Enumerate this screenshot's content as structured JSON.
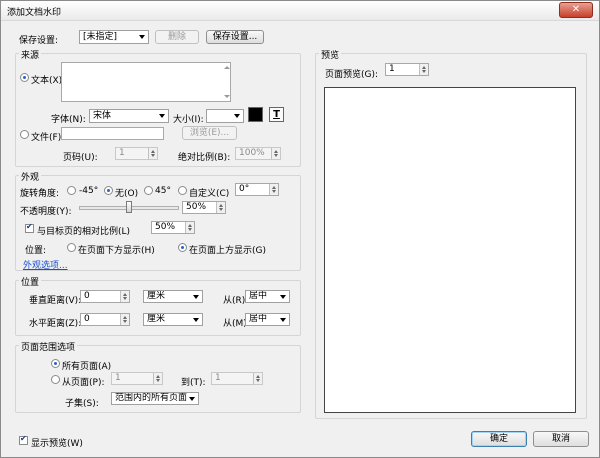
{
  "window": {
    "title": "添加文档水印",
    "close": "✕"
  },
  "top": {
    "save_settings_label": "保存设置:",
    "preset_value": "[未指定]",
    "delete_button": "删除",
    "save_button": "保存设置..."
  },
  "source": {
    "legend": "来源",
    "text_label": "文本(X):",
    "font_label": "字体(N):",
    "font_value": "宋体",
    "size_label": "大小(I):",
    "size_value": "",
    "color": "#000000",
    "file_label": "文件(F):",
    "browse_button": "浏览(E)...",
    "page_label": "页码(U):",
    "page_value": "1",
    "abs_scale_label": "绝对比例(B):",
    "abs_scale_value": "100%"
  },
  "appearance": {
    "legend": "外观",
    "rotation_label": "旋转角度:",
    "rot_neg45": "-45°",
    "rot_none": "无(O)",
    "rot_45": "45°",
    "rot_custom": "自定义(C)",
    "rot_custom_value": "0°",
    "opacity_label": "不透明度(Y):",
    "opacity_value": "50%",
    "opacity_fraction": 0.5,
    "relative_scale_label": "与目标页的相对比例(L)",
    "relative_scale_value": "50%",
    "position_label": "位置:",
    "pos_below": "在页面下方显示(H)",
    "pos_above": "在页面上方显示(G)",
    "options_link": "外观选项..."
  },
  "position": {
    "legend": "位置",
    "vertical_label": "垂直距离(V):",
    "vertical_value": "0",
    "vertical_unit": "厘米",
    "from_r_label": "从(R)",
    "from_r_value": "居中",
    "horizontal_label": "水平距离(Z):",
    "horizontal_value": "0",
    "horizontal_unit": "厘米",
    "from_m_label": "从(M)",
    "from_m_value": "居中"
  },
  "page_range": {
    "legend": "页面范围选项",
    "all_pages": "所有页面(A)",
    "from_page": "从页面(P):",
    "from_value": "1",
    "to_label": "到(T):",
    "to_value": "1",
    "subset_label": "子集(S):",
    "subset_value": "范围内的所有页面"
  },
  "preview": {
    "legend": "预览",
    "page_label": "页面预览(G):",
    "page_value": "1"
  },
  "footer": {
    "show_preview": "显示预览(W)",
    "ok_button": "确定",
    "cancel_button": "取消"
  }
}
